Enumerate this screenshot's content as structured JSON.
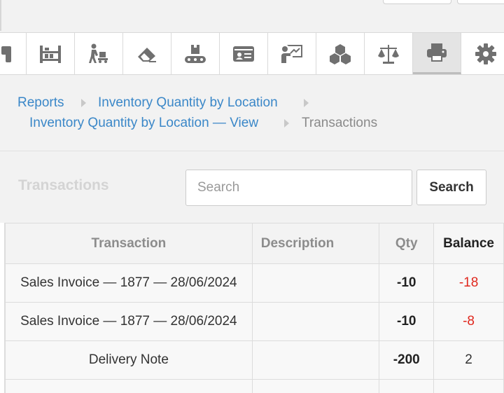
{
  "toolbar": {
    "items": [
      {
        "icon": "scanner-icon",
        "active": false
      },
      {
        "icon": "shelf-icon",
        "active": false
      },
      {
        "icon": "worker-cart-icon",
        "active": false
      },
      {
        "icon": "eraser-icon",
        "active": false
      },
      {
        "icon": "conveyor-icon",
        "active": false
      },
      {
        "icon": "id-card-icon",
        "active": false
      },
      {
        "icon": "presentation-chart-icon",
        "active": false
      },
      {
        "icon": "cubes-icon",
        "active": false
      },
      {
        "icon": "balance-scale-icon",
        "active": false
      },
      {
        "icon": "printer-icon",
        "active": true
      },
      {
        "icon": "gear-icon",
        "active": false
      }
    ]
  },
  "breadcrumb": {
    "reports": "Reports",
    "inventory_by_location": "Inventory Quantity by Location",
    "inventory_view": "Inventory Quantity by Location — View",
    "current": "Transactions"
  },
  "header": {
    "title": "Transactions",
    "search_placeholder": "Search",
    "search_value": "",
    "search_button": "Search"
  },
  "table": {
    "columns": {
      "transaction": "Transaction",
      "description": "Description",
      "qty": "Qty",
      "balance": "Balance"
    },
    "rows": [
      {
        "transaction": "Sales Invoice — 1877 — 28/06/2024",
        "description": "",
        "qty": "-10",
        "balance": "-18"
      },
      {
        "transaction": "Sales Invoice — 1877 — 28/06/2024",
        "description": "",
        "qty": "-10",
        "balance": "-8"
      },
      {
        "transaction": "Delivery Note",
        "description": "",
        "qty": "-200",
        "balance": "2"
      }
    ]
  },
  "colors": {
    "link": "#3a87c8",
    "negative": "#e0281e",
    "icon": "#707070"
  }
}
